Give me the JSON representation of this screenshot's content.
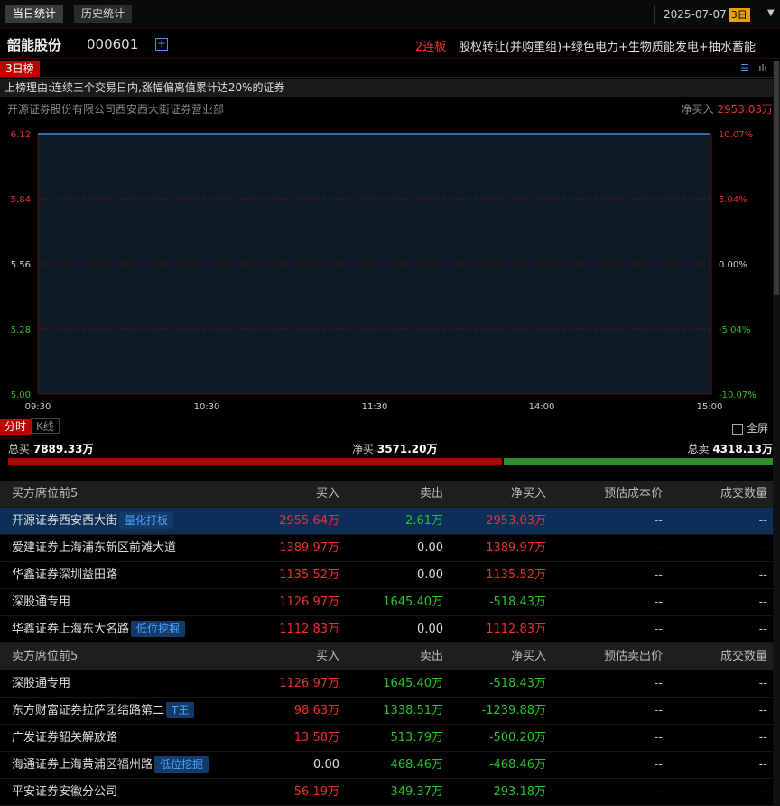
{
  "topbar": {
    "tabs": [
      "当日统计",
      "历史统计"
    ],
    "date": "2025-07-07",
    "period_badge": "3日",
    "dropdown_glyph": "▼"
  },
  "stock": {
    "name": "韶能股份",
    "code": "000601",
    "plus_glyph": "+",
    "streak": "2连板",
    "concepts": "股权转让(并购重组)+绿色电力+生物质能发电+抽水蓄能"
  },
  "list_tag": "3日榜",
  "list_icons": {
    "list_glyph": "☰",
    "bar_glyph": "ılı"
  },
  "reason": "上榜理由:连续三个交易日内,涨幅偏离值累计达20%的证券",
  "broker": "开源证券股份有限公司西安西大街证券营业部",
  "netbuy_label": "净买入",
  "netbuy_value": "2953.03万",
  "chart_data": {
    "type": "line",
    "x_ticks": [
      "09:30",
      "10:30",
      "11:30",
      "14:00",
      "15:00"
    ],
    "y_ticks_left": [
      "6.12",
      "5.84",
      "5.56",
      "5.28",
      "5.00"
    ],
    "y_ticks_right": [
      "10.07%",
      "5.04%",
      "0.00%",
      "-5.04%",
      "-10.07%"
    ],
    "ylim": [
      5.0,
      6.12
    ],
    "series": [
      {
        "x": [
          "09:30",
          "15:00"
        ],
        "values": [
          6.12,
          6.12
        ]
      }
    ],
    "grid": true,
    "colors": {
      "line": "#3a8fd8",
      "fill": "#0e1a24",
      "grid": "#5a1010",
      "up": "#e83030",
      "down": "#28c228",
      "zero": "#d0d0d0"
    }
  },
  "chart_tabs": {
    "intraday": "分时",
    "kline": "K线",
    "fullscreen": "全屏"
  },
  "summary": {
    "total_buy_label": "总买",
    "total_buy": "7889.33万",
    "net_buy_label": "净买",
    "net_buy": "3571.20万",
    "total_sell_label": "总卖",
    "total_sell": "4318.13万",
    "buy_value": 7889.33,
    "sell_value": 4318.13
  },
  "buy_table": {
    "headers": [
      "买方席位前5",
      "买入",
      "卖出",
      "净买入",
      "预估成本价",
      "成交数量"
    ],
    "rows": [
      {
        "name": "开源证券西安西大街",
        "tag": "量化打板",
        "buy": "2955.64万",
        "sell": "2.61万",
        "net": "2953.03万",
        "price": "--",
        "qty": "--"
      },
      {
        "name": "爱建证券上海浦东新区前滩大道",
        "tag": "",
        "buy": "1389.97万",
        "sell": "0.00",
        "net": "1389.97万",
        "price": "--",
        "qty": "--"
      },
      {
        "name": "华鑫证券深圳益田路",
        "tag": "",
        "buy": "1135.52万",
        "sell": "0.00",
        "net": "1135.52万",
        "price": "--",
        "qty": "--"
      },
      {
        "name": "深股通专用",
        "tag": "",
        "buy": "1126.97万",
        "sell": "1645.40万",
        "net": "-518.43万",
        "price": "--",
        "qty": "--"
      },
      {
        "name": "华鑫证券上海东大名路",
        "tag": "低位挖掘",
        "buy": "1112.83万",
        "sell": "0.00",
        "net": "1112.83万",
        "price": "--",
        "qty": "--"
      }
    ]
  },
  "sell_table": {
    "headers": [
      "卖方席位前5",
      "买入",
      "卖出",
      "净买入",
      "预估卖出价",
      "成交数量"
    ],
    "rows": [
      {
        "name": "深股通专用",
        "tag": "",
        "buy": "1126.97万",
        "sell": "1645.40万",
        "net": "-518.43万",
        "price": "--",
        "qty": "--"
      },
      {
        "name": "东方财富证券拉萨团结路第二",
        "tag": "T王",
        "buy": "98.63万",
        "sell": "1338.51万",
        "net": "-1239.88万",
        "price": "--",
        "qty": "--"
      },
      {
        "name": "广发证券韶关解放路",
        "tag": "",
        "buy": "13.58万",
        "sell": "513.79万",
        "net": "-500.20万",
        "price": "--",
        "qty": "--"
      },
      {
        "name": "海通证券上海黄浦区福州路",
        "tag": "低位挖掘",
        "buy": "0.00",
        "sell": "468.46万",
        "net": "-468.46万",
        "price": "--",
        "qty": "--"
      },
      {
        "name": "平安证券安徽分公司",
        "tag": "",
        "buy": "56.19万",
        "sell": "349.37万",
        "net": "-293.18万",
        "price": "--",
        "qty": "--"
      }
    ]
  }
}
